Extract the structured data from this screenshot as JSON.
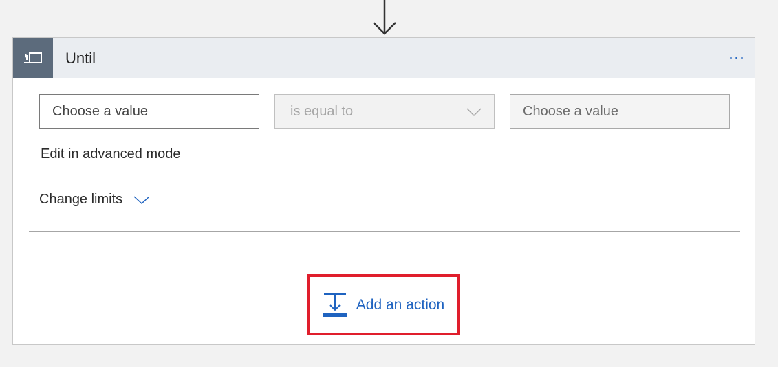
{
  "card": {
    "title": "Until",
    "icon": "loop-until-icon",
    "menu_icon": "more-options-icon"
  },
  "condition": {
    "left_placeholder": "Choose a value",
    "operator": "is equal to",
    "right_placeholder": "Choose a value"
  },
  "links": {
    "advanced_mode": "Edit in advanced mode",
    "change_limits": "Change limits"
  },
  "add_action": {
    "label": "Add an action",
    "icon": "add-action-icon"
  },
  "colors": {
    "accent": "#1f63c0",
    "highlight_border": "#e01e2c",
    "header_bg": "#eaedf1",
    "icon_box_bg": "#5c6b7c"
  }
}
